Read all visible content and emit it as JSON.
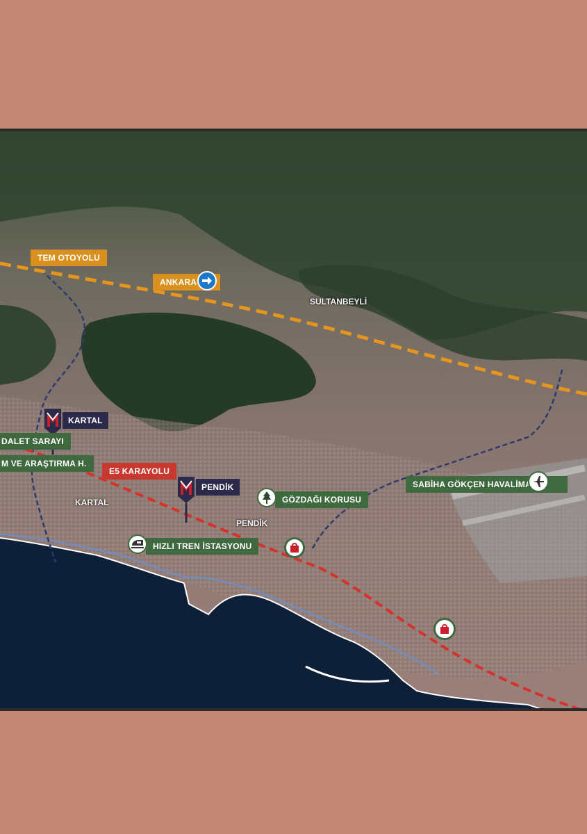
{
  "colors": {
    "page_background": "#c38672",
    "sea": "#0e2038",
    "tem_route": "#e6951f",
    "e5_route": "#d4322a",
    "rail_route": "#2d3a6e",
    "metro_marker": "#c8202c",
    "green_tag": "#3f6a3f",
    "navy_tag": "#2c2a4a"
  },
  "roads": {
    "tem": "TEM OTOYOLU",
    "ankara": "ANKARA",
    "e5": "E5 KARAYOLU"
  },
  "metro": {
    "kartal": "KARTAL",
    "pendik": "PENDİK"
  },
  "places": {
    "sultanbeyli": "SULTANBEYLİ",
    "kartal": "KARTAL",
    "pendik": "PENDİK"
  },
  "poi": {
    "adalet": "DALET SARAYI",
    "arastirma": "M VE ARAŞTIRMA H.",
    "gozdagi": "GÖZDAĞI KORUSU",
    "tren": "HIZLI TREN İSTASYONU",
    "sabiha": "SABİHA GÖKÇEN HAVALİMANI"
  },
  "icons": {
    "ankara_arrow": "arrow-right-icon",
    "metro": "metro-m-icon",
    "tree": "tree-icon",
    "train": "train-icon",
    "shopping": "shopping-bag-icon",
    "airplane": "airplane-icon"
  }
}
